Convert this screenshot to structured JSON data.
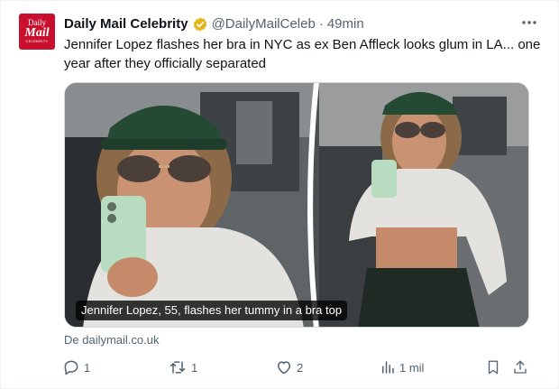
{
  "tweet": {
    "avatar": {
      "line1": "Daily",
      "line2": "Mail",
      "line3": "CELEBRITY"
    },
    "author_name": "Daily Mail Celebrity",
    "handle": "@DailyMailCeleb",
    "separator": "·",
    "time": "49min",
    "more_icon": "more-horizontal-icon",
    "text": "Jennifer Lopez flashes her bra in NYC as ex Ben Affleck looks glum in LA... one year after they officially separated",
    "media": {
      "caption": "Jennifer Lopez, 55, flashes her tummy in a bra top"
    },
    "source": "De dailymail.co.uk",
    "actions": {
      "reply_count": "1",
      "retweet_count": "1",
      "like_count": "2",
      "views_count": "1 mil"
    }
  },
  "colors": {
    "brand_red": "#c8102e",
    "verified_gold": "#e2b719",
    "muted_text": "#536471",
    "text": "#0f1419"
  },
  "icons": [
    "verified-badge-icon",
    "reply-icon",
    "retweet-icon",
    "like-icon",
    "views-icon",
    "bookmark-icon",
    "share-icon"
  ]
}
